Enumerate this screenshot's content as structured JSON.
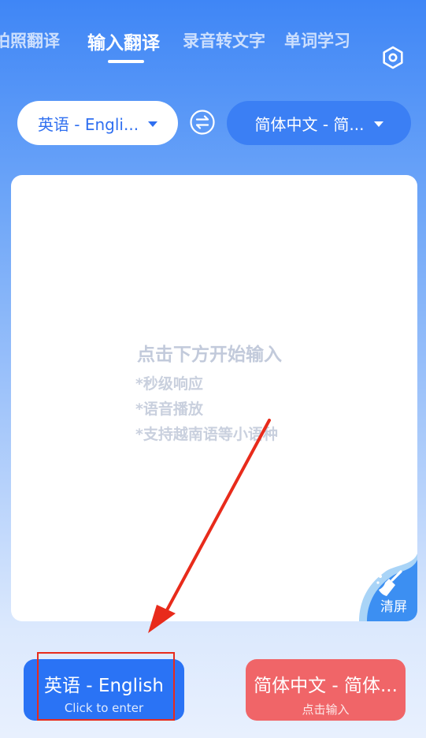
{
  "tabs": [
    {
      "label": "拍照翻译",
      "active": false
    },
    {
      "label": "输入翻译",
      "active": true
    },
    {
      "label": "录音转文字",
      "active": false
    },
    {
      "label": "单词学习",
      "active": false
    }
  ],
  "settings_icon": "hexagon-settings-icon",
  "language_bar": {
    "source": "英语 - Engli...",
    "target": "简体中文 - 简...",
    "swap_icon": "swap-arrows-icon"
  },
  "input_card": {
    "hint_title": "点击下方开始输入",
    "hint_lines": [
      "*秒级响应",
      "*语音播放",
      "*支持越南语等小语种"
    ],
    "clear_label": "清屏",
    "clear_icon": "broom-icon"
  },
  "bottom_buttons": {
    "source": {
      "label": "英语 - English",
      "sub": "Click to enter"
    },
    "target": {
      "label": "简体中文 - 简体...",
      "sub": "点击输入"
    }
  },
  "colors": {
    "accent_blue": "#2a73f5",
    "target_red": "#f06568",
    "annotation_red": "#e82b1b"
  }
}
